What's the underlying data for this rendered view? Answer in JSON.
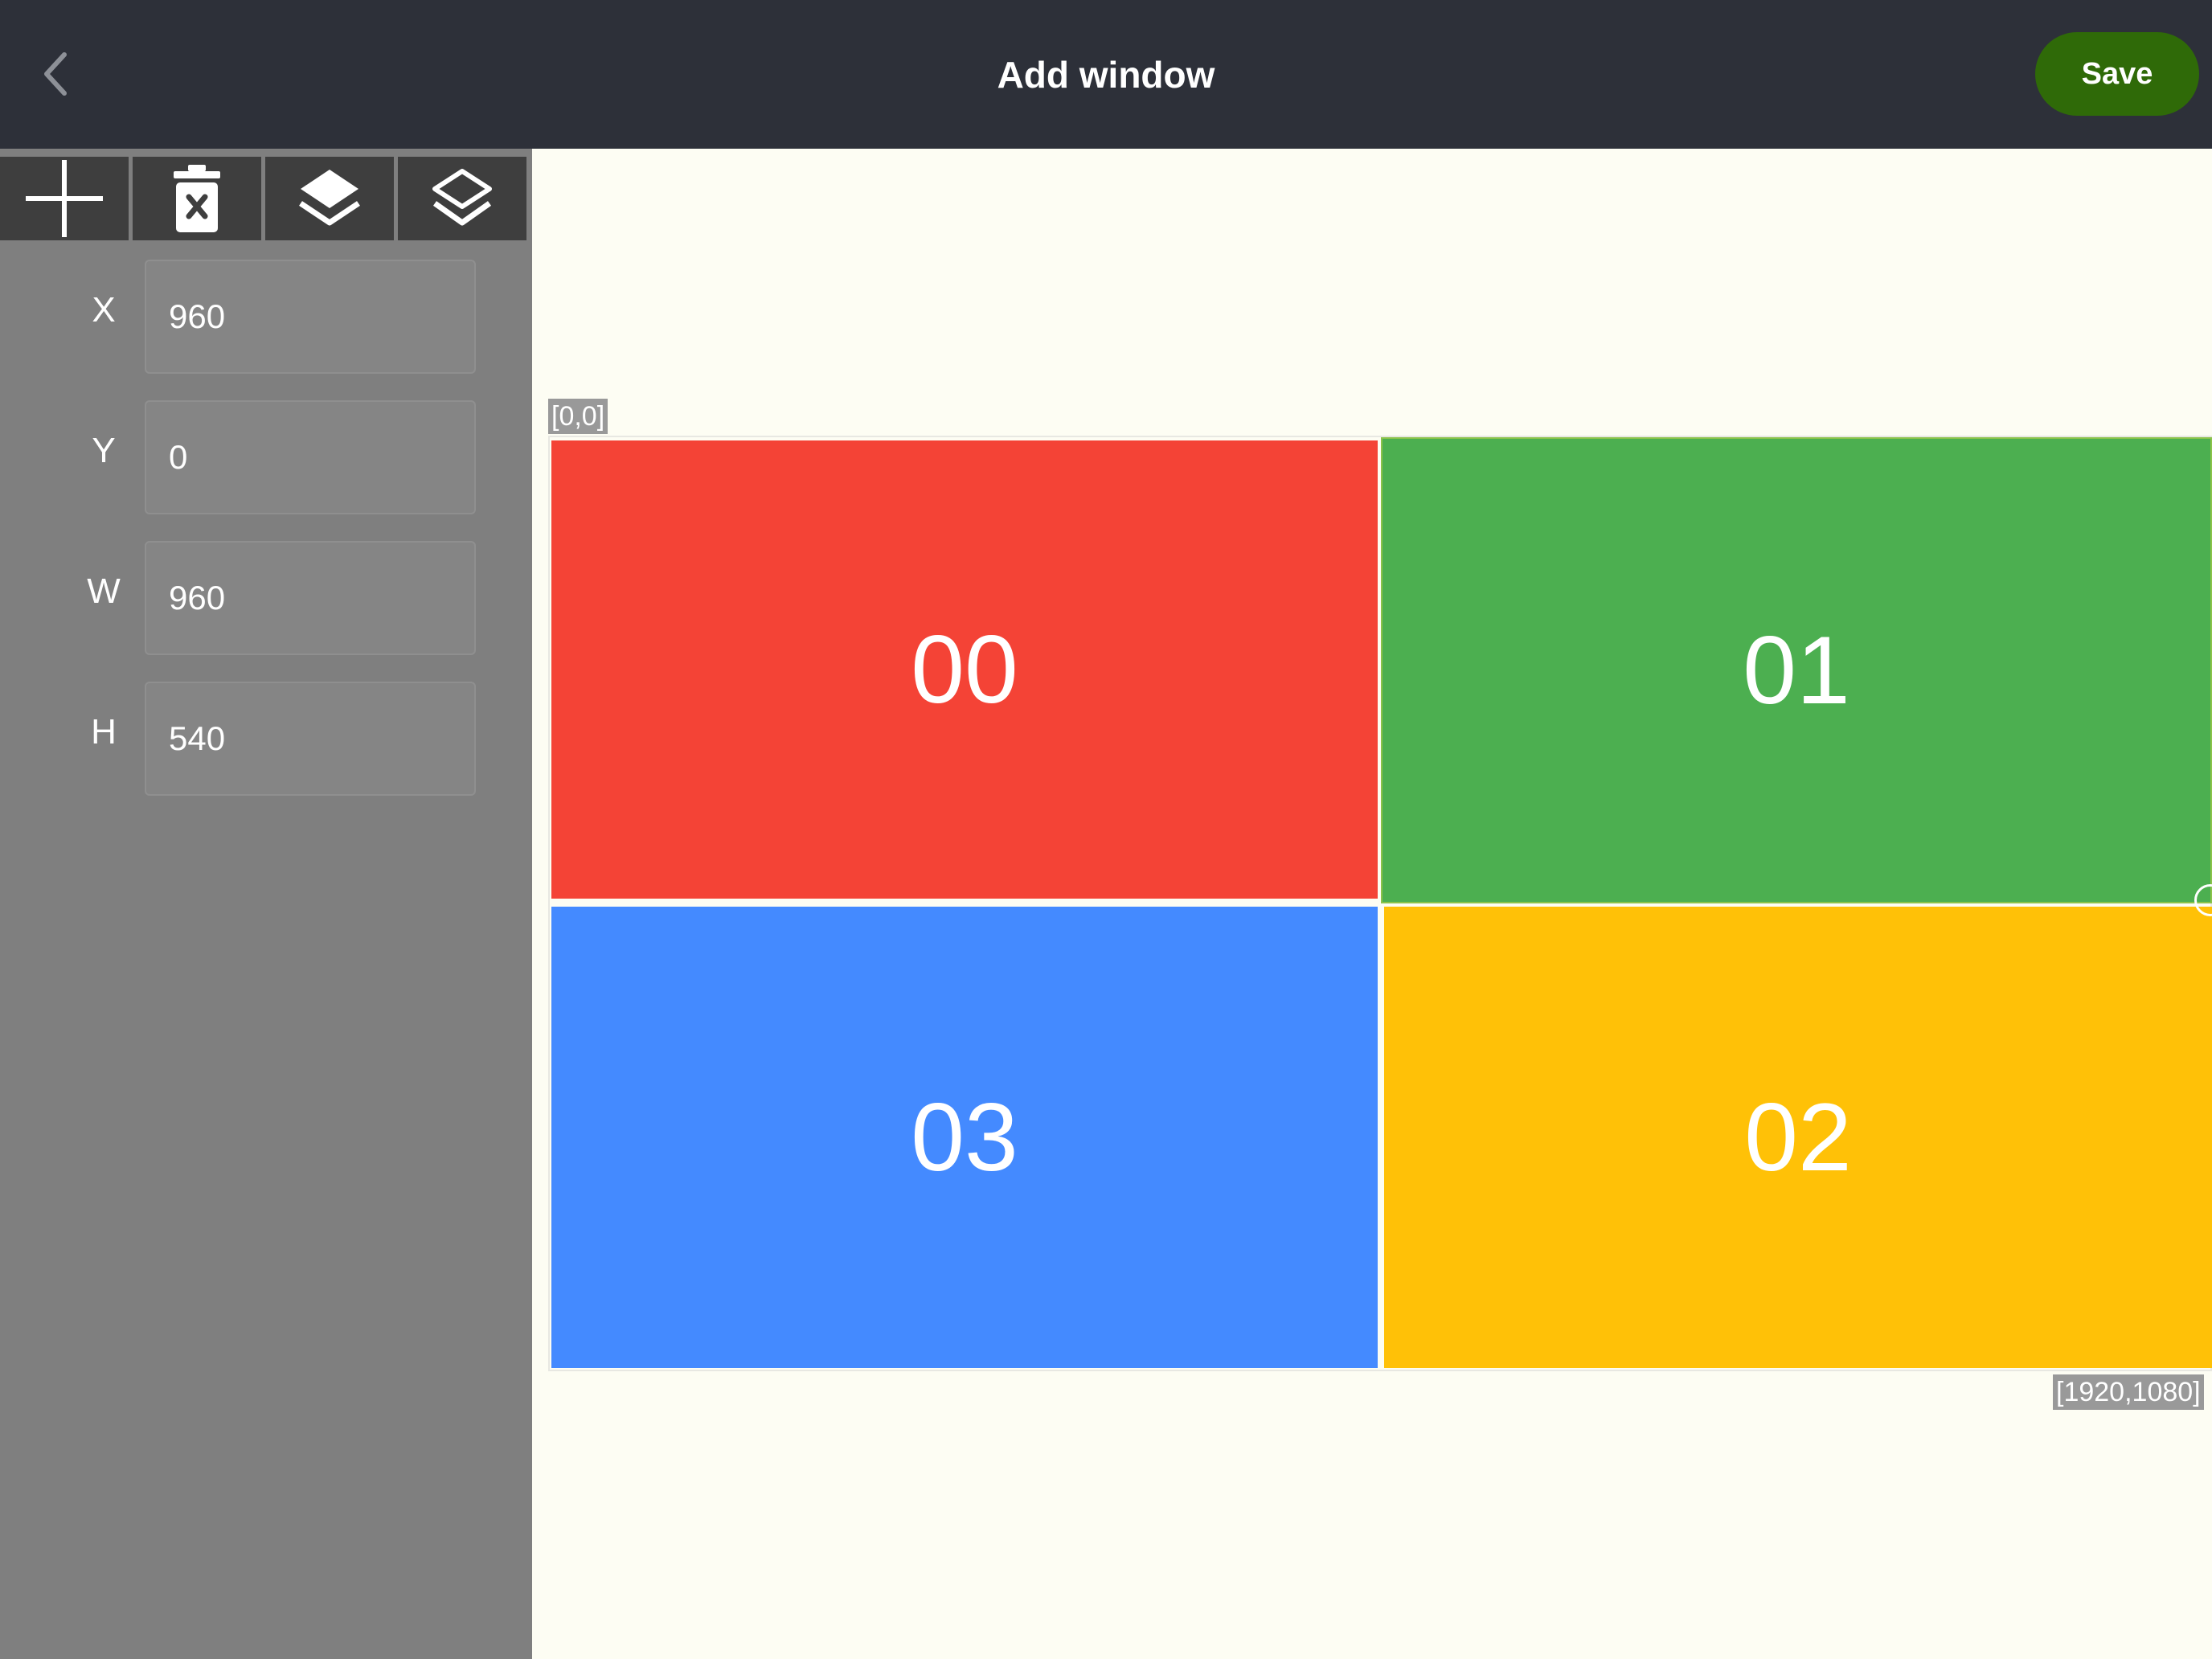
{
  "header": {
    "title": "Add window",
    "save_label": "Save"
  },
  "toolbar": {
    "buttons": [
      {
        "icon": "plus-icon"
      },
      {
        "icon": "trash-icon"
      },
      {
        "icon": "layers-filled-icon"
      },
      {
        "icon": "layers-outline-icon"
      }
    ]
  },
  "fields": {
    "x": {
      "label": "X",
      "value": "960"
    },
    "y": {
      "label": "Y",
      "value": "0"
    },
    "w": {
      "label": "W",
      "value": "960"
    },
    "h": {
      "label": "H",
      "value": "540"
    }
  },
  "canvas": {
    "origin_label": "[0,0]",
    "extent_label": "[1920,1080]",
    "windows": [
      {
        "label": "00",
        "color": "#f44336"
      },
      {
        "label": "01",
        "color": "#4caf50"
      },
      {
        "label": "02",
        "color": "#ffc107"
      },
      {
        "label": "03",
        "color": "#448aff"
      }
    ]
  }
}
